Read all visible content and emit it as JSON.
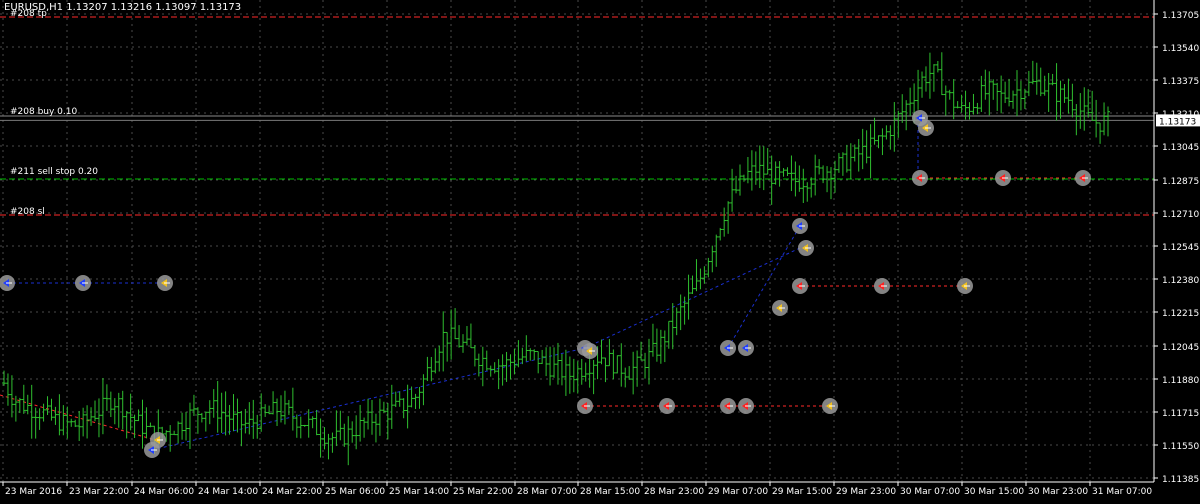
{
  "header": {
    "symbol": "EURUSD,H1",
    "ohlc": "1.13207 1.13216 1.13097 1.13173"
  },
  "price_label": "1.13173",
  "order_labels": {
    "tp": "#208 tp",
    "buy": "#208 buy 0.10",
    "sell_stop": "#211 sell stop 0.20",
    "sl": "#208 sl"
  },
  "colors": {
    "background": "#000000",
    "grid": "#4a4a4a",
    "candle": "#2fbf2f",
    "tp_sl_line": "#ff2a2a",
    "buy_line": "#8a8a8a",
    "sell_stop_line": "#00c000",
    "trade_line_blue": "#1a2fd0",
    "trade_line_red": "#ff2a2a",
    "marker_fill": "#9a9a9a",
    "price_box": "#ffffff"
  },
  "chart_data": {
    "type": "candlestick",
    "symbol": "EURUSD",
    "timeframe": "H1",
    "y_ticks": [
      "1.13705",
      "1.13540",
      "1.13375",
      "1.13210",
      "1.13045",
      "1.12875",
      "1.12710",
      "1.12545",
      "1.12380",
      "1.12215",
      "1.12045",
      "1.11880",
      "1.11715",
      "1.11550",
      "1.11385"
    ],
    "x_ticks": [
      "23 Mar 2016",
      "23 Mar 22:00",
      "24 Mar 06:00",
      "24 Mar 14:00",
      "24 Mar 22:00",
      "25 Mar 06:00",
      "25 Mar 14:00",
      "25 Mar 22:00",
      "28 Mar 07:00",
      "28 Mar 15:00",
      "28 Mar 23:00",
      "29 Mar 07:00",
      "29 Mar 15:00",
      "29 Mar 23:00",
      "30 Mar 07:00",
      "30 Mar 15:00",
      "30 Mar 23:00",
      "31 Mar 07:00"
    ],
    "ylim": [
      1.11385,
      1.13705
    ],
    "current_price": 1.13173,
    "levels": {
      "tp": 1.1369,
      "buy": 1.13195,
      "sell_stop": 1.1288,
      "sl": 1.127
    },
    "trend_path": [
      1.1186,
      1.1178,
      1.1175,
      1.1173,
      1.1171,
      1.1168,
      1.1166,
      1.1165,
      1.1165,
      1.117,
      1.1173,
      1.1178,
      1.1175,
      1.1169,
      1.1165,
      1.1161,
      1.116,
      1.1163,
      1.1165,
      1.117,
      1.1172,
      1.1174,
      1.1172,
      1.1169,
      1.1166,
      1.1165,
      1.1168,
      1.117,
      1.1173,
      1.1171,
      1.1168,
      1.1166,
      1.1163,
      1.116,
      1.1158,
      1.116,
      1.1163,
      1.1166,
      1.1169,
      1.1171,
      1.1173,
      1.1175,
      1.1178,
      1.1188,
      1.12,
      1.121,
      1.1208,
      1.1205,
      1.1201,
      1.1198,
      1.1196,
      1.1195,
      1.1197,
      1.1199,
      1.12,
      1.1197,
      1.1194,
      1.1192,
      1.119,
      1.1193,
      1.1196,
      1.12,
      1.1197,
      1.1194,
      1.1192,
      1.1195,
      1.1199,
      1.1204,
      1.1212,
      1.122,
      1.1228,
      1.1235,
      1.1248,
      1.1262,
      1.1275,
      1.1283,
      1.129,
      1.1293,
      1.1291,
      1.1289,
      1.1288,
      1.1287,
      1.1288,
      1.129,
      1.1292,
      1.1294,
      1.1296,
      1.1299,
      1.1302,
      1.1305,
      1.1309,
      1.1315,
      1.1322,
      1.133,
      1.1338,
      1.1342,
      1.1335,
      1.1327,
      1.1322,
      1.1325,
      1.133,
      1.1332,
      1.1329,
      1.1331,
      1.1333,
      1.1335,
      1.1336,
      1.1333,
      1.133,
      1.1328,
      1.1323,
      1.1318,
      1.1316,
      1.1317
    ]
  }
}
